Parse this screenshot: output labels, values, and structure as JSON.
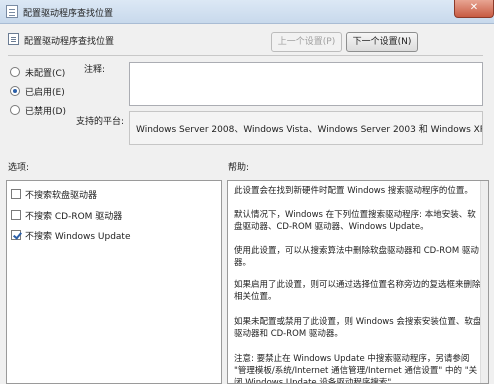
{
  "window": {
    "title": "配置驱动程序查找位置",
    "close_glyph": "✕"
  },
  "header": {
    "title": "配置驱动程序查找位置",
    "prev_button": "上一个设置(P)",
    "next_button": "下一个设置(N)"
  },
  "state": {
    "options": [
      {
        "label": "未配置(C)",
        "selected": false
      },
      {
        "label": "已启用(E)",
        "selected": true
      },
      {
        "label": "已禁用(D)",
        "selected": false
      }
    ]
  },
  "comment": {
    "label": "注释:",
    "value": ""
  },
  "platform": {
    "label": "支持的平台:",
    "value": "Windows Server 2008、Windows Vista、Windows Server 2003 和 Windows XP"
  },
  "options_section": {
    "label": "选项:",
    "checkboxes": [
      {
        "label": "不搜索软盘驱动器",
        "checked": false
      },
      {
        "label": "不搜索 CD-ROM 驱动器",
        "checked": false
      },
      {
        "label": "不搜索 Windows Update",
        "checked": true
      }
    ]
  },
  "help_section": {
    "label": "帮助:",
    "paragraphs": [
      "此设置会在找到新硬件时配置 Windows 搜索驱动程序的位置。",
      "默认情况下，Windows 在下列位置搜索驱动程序: 本地安装、软盘驱动器、CD-ROM 驱动器、Windows Update。",
      "使用此设置，可以从搜索算法中删除软盘驱动器和 CD-ROM 驱动器。",
      "如果启用了此设置，则可以通过选择位置名称旁边的复选框来删除相关位置。",
      "如果未配置或禁用了此设置，则 Windows 会搜索安装位置、软盘驱动器和 CD-ROM 驱动器。",
      "注意: 要禁止在 Windows Update 中搜索驱动程序，另请参阅 \"管理模板/系统/Internet 通信管理/Internet 通信设置\" 中的 \"关闭 Windows Update 设备驱动程序搜索\"。"
    ]
  }
}
